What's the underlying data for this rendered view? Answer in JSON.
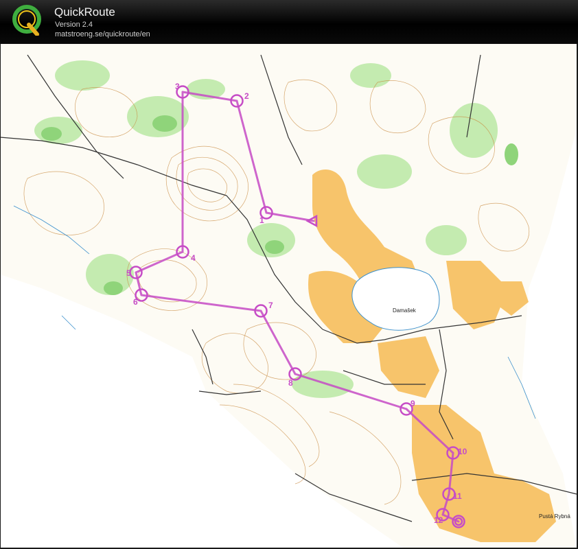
{
  "app": {
    "title": "QuickRoute",
    "version": "Version 2.4",
    "url": "matstroeng.se/quickroute/en",
    "logo_letter": "Q"
  },
  "map": {
    "place_labels": [
      "Damašek",
      "Pustá Rybná"
    ],
    "colors": {
      "course": "#c64cc6",
      "open_land": "#f7c46b",
      "forest_green": "#8fd47a",
      "light_green": "#c4ebb0",
      "contour": "#c8893e",
      "water": "#8fc9e8",
      "paper": "#ffffff",
      "header_bg": "#0a0a0a"
    },
    "controls": [
      "1",
      "2",
      "3",
      "4",
      "5",
      "6",
      "7",
      "8",
      "9",
      "10",
      "11",
      "12"
    ]
  }
}
